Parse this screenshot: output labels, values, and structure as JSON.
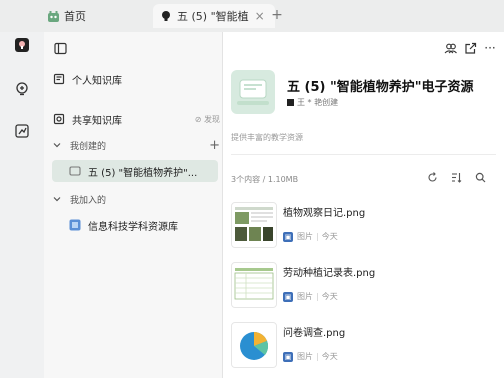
{
  "tabs": [
    {
      "label": "首页"
    },
    {
      "label": "五 (5) \"智能植",
      "close": "×"
    }
  ],
  "tab_add": "+",
  "sidebar": {
    "personal": "个人知识库",
    "shared": "共享知识库",
    "discover": "发现",
    "created_section": "我创建的",
    "add": "+",
    "created_item": "五 (5) \"智能植物养护\"...",
    "joined_section": "我加入的",
    "joined_item": "信息科技学科资源库"
  },
  "kb": {
    "title": "五 (5) \"智能植物养护\"电子资源",
    "author": "王 * 艳创建",
    "description": "提供丰富的教学资源",
    "stats": "3个内容 / 1.10MB"
  },
  "files": [
    {
      "name": "植物观察日记.png",
      "type": "图片",
      "time": "今天"
    },
    {
      "name": "劳动种植记录表.png",
      "type": "图片",
      "time": "今天"
    },
    {
      "name": "问卷调查.png",
      "type": "图片",
      "time": "今天"
    }
  ],
  "colors": {
    "accent": "#2e7d5b",
    "selected_bg": "#dfe8e3",
    "file_badge": "#3e6fb8"
  }
}
